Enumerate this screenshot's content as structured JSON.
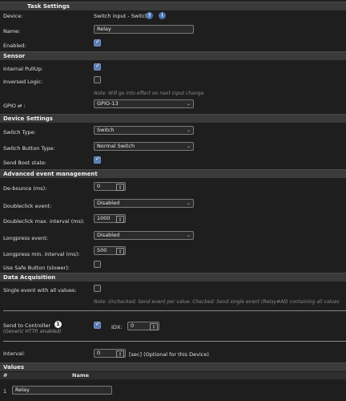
{
  "task_settings": {
    "header": "Task Settings",
    "device_label": "Device:",
    "device_value": "Switch input - Switch",
    "help_icon": "?",
    "info_icon": "i",
    "name_label": "Name:",
    "name_value": "Relay",
    "enabled_label": "Enabled:",
    "enabled": true
  },
  "sensor": {
    "header": "Sensor",
    "pullup_label": "Internal PullUp:",
    "pullup": true,
    "inversed_label": "Inversed Logic:",
    "inversed": false,
    "note": "Note: Will go into effect on next input change.",
    "gpio_label": "GPIO ⇄ :",
    "gpio_value": "GPIO-13"
  },
  "device_settings": {
    "header": "Device Settings",
    "switch_type_label": "Switch Type:",
    "switch_type_value": "Switch",
    "button_type_label": "Switch Button Type:",
    "button_type_value": "Normal Switch",
    "boot_label": "Send Boot state:",
    "boot": true
  },
  "advanced": {
    "header": "Advanced event management",
    "debounce_label": "De-bounce (ms):",
    "debounce_value": "0",
    "doubleclick_label": "Doubleclick event:",
    "doubleclick_value": "Disabled",
    "doubleclick_interval_label": "Doubleclick max. interval (ms):",
    "doubleclick_interval_value": "1000",
    "longpress_label": "Longpress event:",
    "longpress_value": "Disabled",
    "longpress_interval_label": "Longpress min. interval (ms):",
    "longpress_interval_value": "500",
    "safe_button_label": "Use Safe Button (slower):",
    "safe_button": false
  },
  "data_acquisition": {
    "header": "Data Acquisition",
    "single_event_label": "Single event with all values:",
    "single_event": false,
    "note": "Note: Unchecked: Send event per value. Checked: Send single event (Relay#All) containing all values",
    "controller_label": "Send to Controller",
    "controller_badge": "1",
    "controller_sub": "(Generic HTTP, enabled)",
    "controller_checked": true,
    "idx_label": "IDX:",
    "idx_value": "0",
    "interval_label": "Interval:",
    "interval_value": "0",
    "interval_note": "[sec] (Optional for this Device)"
  },
  "values": {
    "header": "Values",
    "col_number": "#",
    "col_name": "Name",
    "rows": [
      {
        "index": "1",
        "name": "Relay"
      }
    ]
  },
  "colors": {
    "background": "#1e1e1e",
    "section": "#3a3a3a",
    "accent": "#5c7db3"
  }
}
